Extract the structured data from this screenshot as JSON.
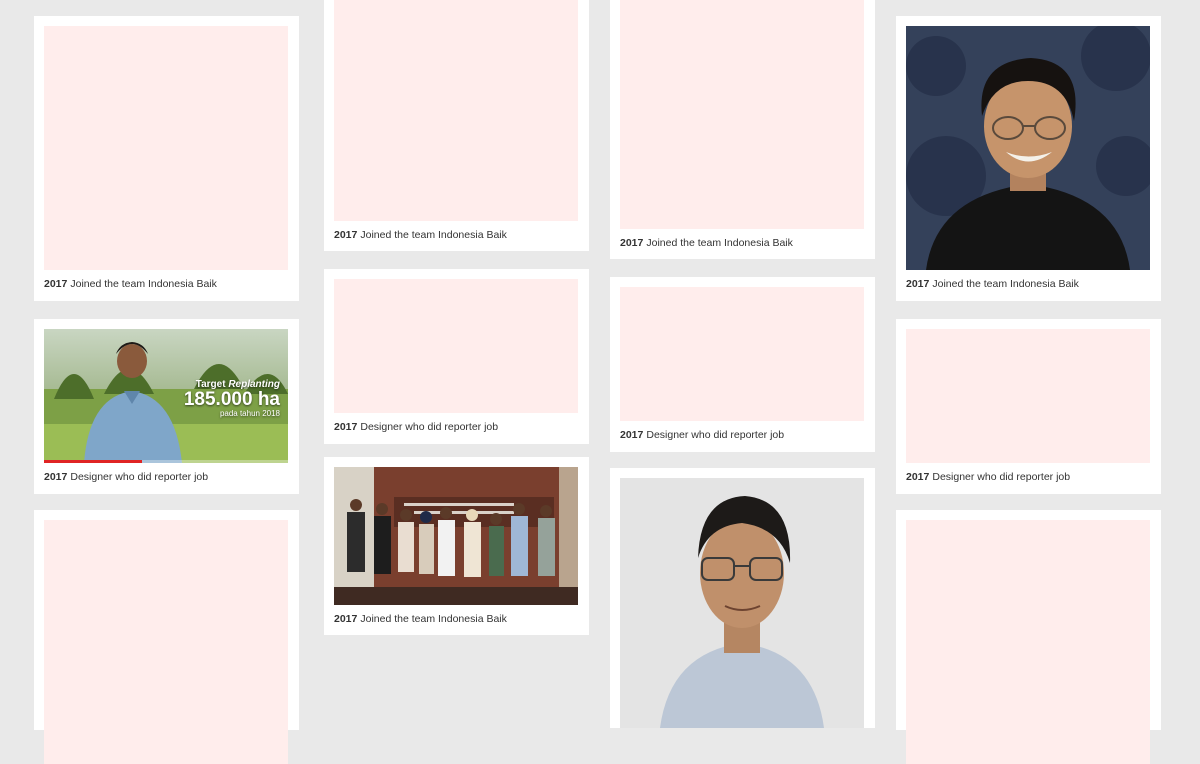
{
  "cards": [
    {
      "year": "2017",
      "text": "Joined the team Indonesia Baik"
    },
    {
      "year": "2017",
      "text": "Designer who did reporter job"
    },
    {
      "year": "2017",
      "text": "Joined the team Indonesia Baik"
    },
    {
      "year": "2017",
      "text": "Designer who did reporter job"
    },
    {
      "year": "2017",
      "text": "Joined the team Indonesia Baik"
    },
    {
      "year": "2017",
      "text": "Joined the team Indonesia Baik"
    },
    {
      "year": "2017",
      "text": "Designer who did reporter job"
    },
    {
      "year": "2017",
      "text": "Joined the team Indonesia Baik"
    },
    {
      "year": "2017",
      "text": "Designer who did reporter job"
    }
  ],
  "video": {
    "line1_a": "Target",
    "line1_b": "Replanting",
    "line2": "185.000 ha",
    "line3": "pada tahun 2018",
    "progress": 0.4
  },
  "colors": {
    "background": "#e9e9e9",
    "placeholder": "#ffedec",
    "card": "#ffffff"
  }
}
